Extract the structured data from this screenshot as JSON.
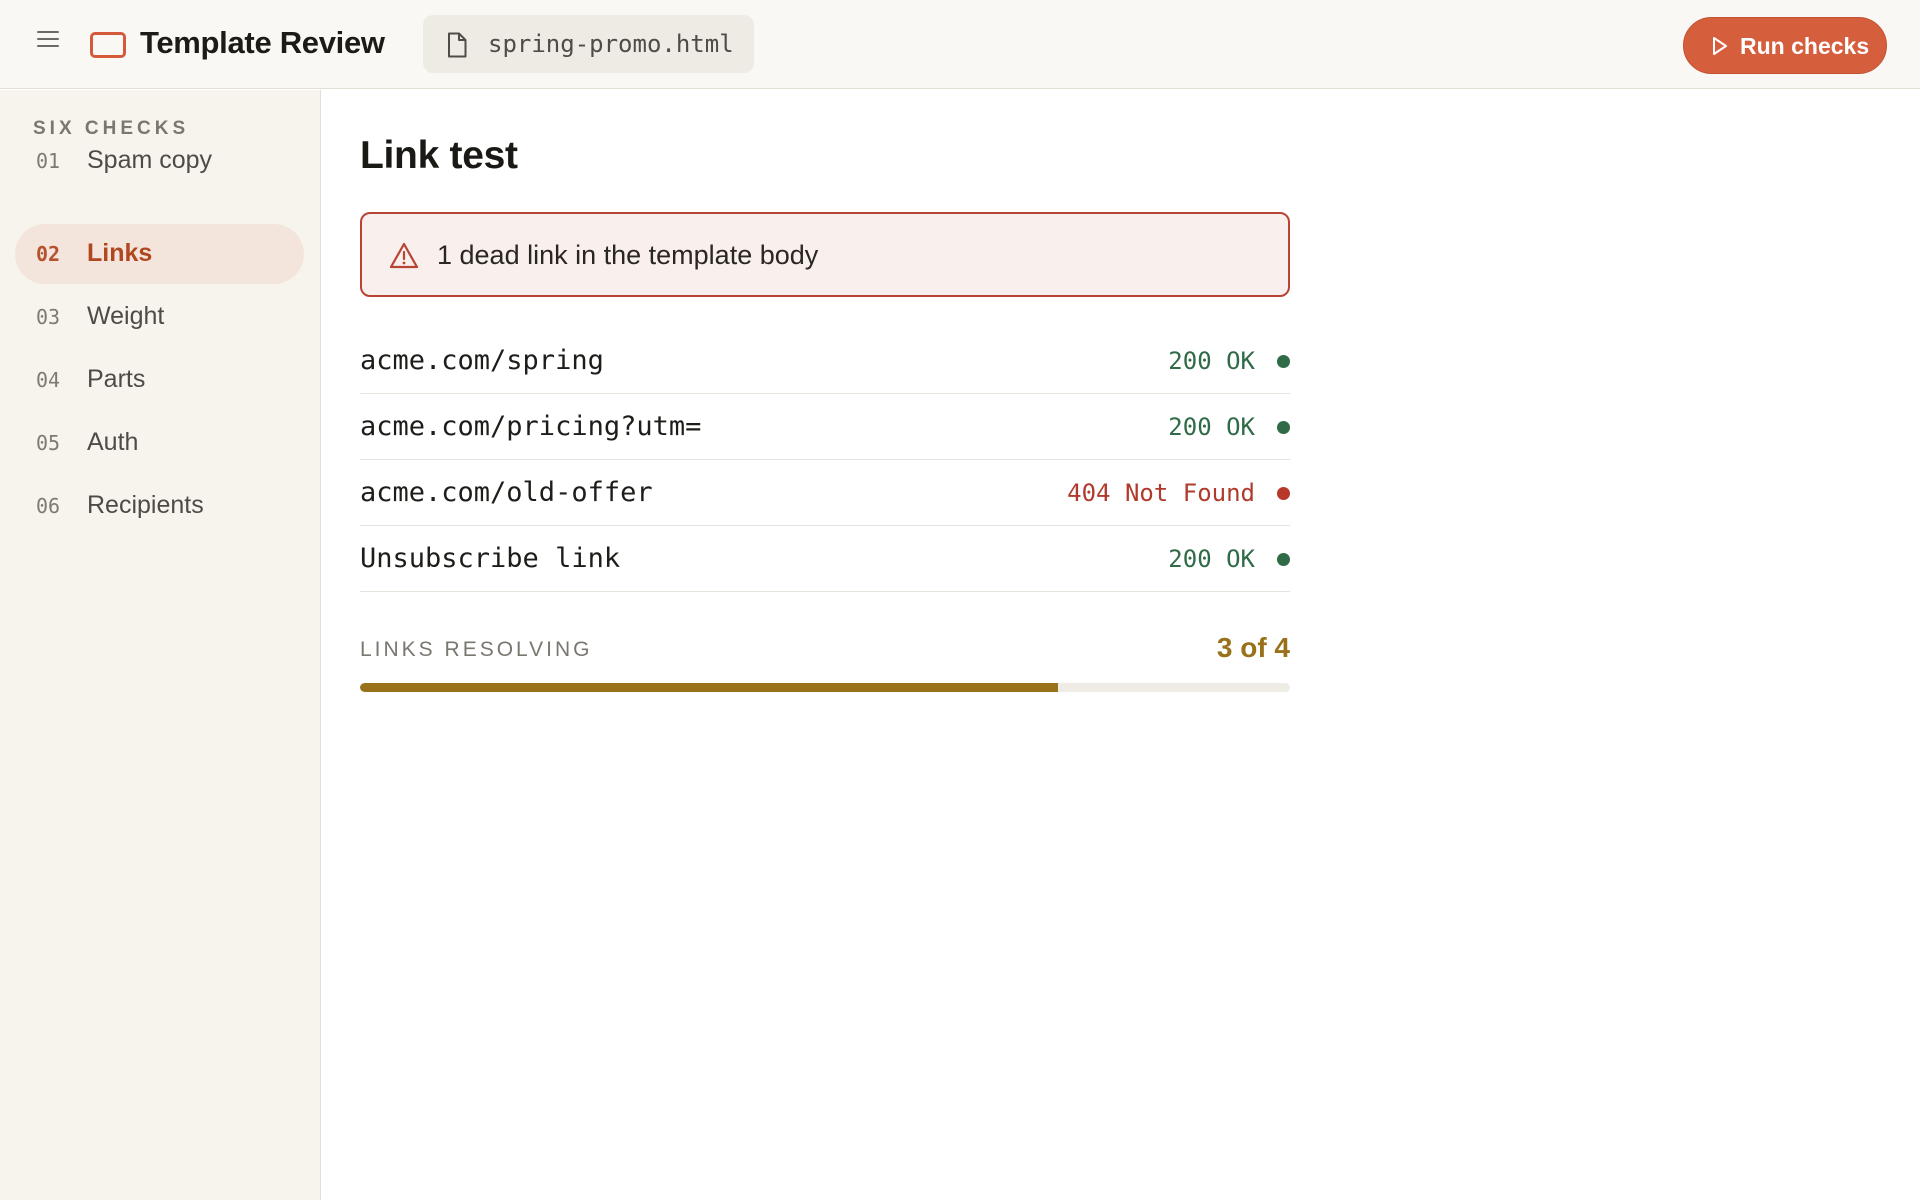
{
  "header": {
    "title": "Template Review",
    "file_name": "spring-promo.html",
    "run_label": "Run checks"
  },
  "sidebar": {
    "heading": "SIX CHECKS",
    "items": [
      {
        "num": "01",
        "label": "Spam copy",
        "active": false
      },
      {
        "num": "02",
        "label": "Links",
        "active": true
      },
      {
        "num": "03",
        "label": "Weight",
        "active": false
      },
      {
        "num": "04",
        "label": "Parts",
        "active": false
      },
      {
        "num": "05",
        "label": "Auth",
        "active": false
      },
      {
        "num": "06",
        "label": "Recipients",
        "active": false
      }
    ]
  },
  "main": {
    "title": "Link test",
    "alert": "1 dead link in the template body",
    "links": [
      {
        "url": "acme.com/spring",
        "status": "200 OK",
        "state": "ok"
      },
      {
        "url": "acme.com/pricing?utm=",
        "status": "200 OK",
        "state": "ok"
      },
      {
        "url": "acme.com/old-offer",
        "status": "404 Not Found",
        "state": "bad"
      },
      {
        "url": "Unsubscribe link",
        "status": "200 OK",
        "state": "ok"
      }
    ],
    "progress": {
      "label": "LINKS RESOLVING",
      "value_text": "3 of 4",
      "fraction": 0.75
    }
  },
  "colors": {
    "accent": "#d55f3c",
    "ok": "#2f6b46",
    "error": "#b03a2c",
    "progress": "#98711a"
  }
}
